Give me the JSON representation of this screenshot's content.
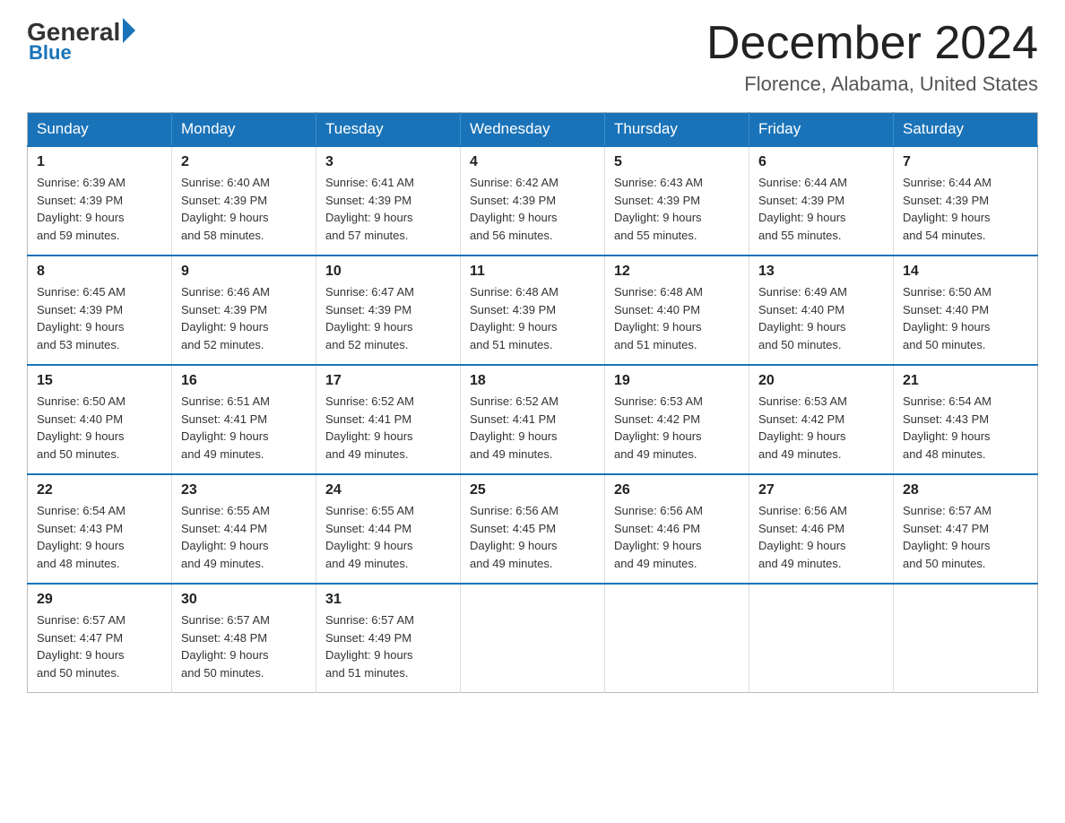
{
  "logo": {
    "general": "General",
    "blue": "Blue"
  },
  "header": {
    "month": "December 2024",
    "location": "Florence, Alabama, United States"
  },
  "weekdays": [
    "Sunday",
    "Monday",
    "Tuesday",
    "Wednesday",
    "Thursday",
    "Friday",
    "Saturday"
  ],
  "weeks": [
    [
      {
        "day": "1",
        "sunrise": "6:39 AM",
        "sunset": "4:39 PM",
        "daylight": "9 hours and 59 minutes."
      },
      {
        "day": "2",
        "sunrise": "6:40 AM",
        "sunset": "4:39 PM",
        "daylight": "9 hours and 58 minutes."
      },
      {
        "day": "3",
        "sunrise": "6:41 AM",
        "sunset": "4:39 PM",
        "daylight": "9 hours and 57 minutes."
      },
      {
        "day": "4",
        "sunrise": "6:42 AM",
        "sunset": "4:39 PM",
        "daylight": "9 hours and 56 minutes."
      },
      {
        "day": "5",
        "sunrise": "6:43 AM",
        "sunset": "4:39 PM",
        "daylight": "9 hours and 55 minutes."
      },
      {
        "day": "6",
        "sunrise": "6:44 AM",
        "sunset": "4:39 PM",
        "daylight": "9 hours and 55 minutes."
      },
      {
        "day": "7",
        "sunrise": "6:44 AM",
        "sunset": "4:39 PM",
        "daylight": "9 hours and 54 minutes."
      }
    ],
    [
      {
        "day": "8",
        "sunrise": "6:45 AM",
        "sunset": "4:39 PM",
        "daylight": "9 hours and 53 minutes."
      },
      {
        "day": "9",
        "sunrise": "6:46 AM",
        "sunset": "4:39 PM",
        "daylight": "9 hours and 52 minutes."
      },
      {
        "day": "10",
        "sunrise": "6:47 AM",
        "sunset": "4:39 PM",
        "daylight": "9 hours and 52 minutes."
      },
      {
        "day": "11",
        "sunrise": "6:48 AM",
        "sunset": "4:39 PM",
        "daylight": "9 hours and 51 minutes."
      },
      {
        "day": "12",
        "sunrise": "6:48 AM",
        "sunset": "4:40 PM",
        "daylight": "9 hours and 51 minutes."
      },
      {
        "day": "13",
        "sunrise": "6:49 AM",
        "sunset": "4:40 PM",
        "daylight": "9 hours and 50 minutes."
      },
      {
        "day": "14",
        "sunrise": "6:50 AM",
        "sunset": "4:40 PM",
        "daylight": "9 hours and 50 minutes."
      }
    ],
    [
      {
        "day": "15",
        "sunrise": "6:50 AM",
        "sunset": "4:40 PM",
        "daylight": "9 hours and 50 minutes."
      },
      {
        "day": "16",
        "sunrise": "6:51 AM",
        "sunset": "4:41 PM",
        "daylight": "9 hours and 49 minutes."
      },
      {
        "day": "17",
        "sunrise": "6:52 AM",
        "sunset": "4:41 PM",
        "daylight": "9 hours and 49 minutes."
      },
      {
        "day": "18",
        "sunrise": "6:52 AM",
        "sunset": "4:41 PM",
        "daylight": "9 hours and 49 minutes."
      },
      {
        "day": "19",
        "sunrise": "6:53 AM",
        "sunset": "4:42 PM",
        "daylight": "9 hours and 49 minutes."
      },
      {
        "day": "20",
        "sunrise": "6:53 AM",
        "sunset": "4:42 PM",
        "daylight": "9 hours and 49 minutes."
      },
      {
        "day": "21",
        "sunrise": "6:54 AM",
        "sunset": "4:43 PM",
        "daylight": "9 hours and 48 minutes."
      }
    ],
    [
      {
        "day": "22",
        "sunrise": "6:54 AM",
        "sunset": "4:43 PM",
        "daylight": "9 hours and 48 minutes."
      },
      {
        "day": "23",
        "sunrise": "6:55 AM",
        "sunset": "4:44 PM",
        "daylight": "9 hours and 49 minutes."
      },
      {
        "day": "24",
        "sunrise": "6:55 AM",
        "sunset": "4:44 PM",
        "daylight": "9 hours and 49 minutes."
      },
      {
        "day": "25",
        "sunrise": "6:56 AM",
        "sunset": "4:45 PM",
        "daylight": "9 hours and 49 minutes."
      },
      {
        "day": "26",
        "sunrise": "6:56 AM",
        "sunset": "4:46 PM",
        "daylight": "9 hours and 49 minutes."
      },
      {
        "day": "27",
        "sunrise": "6:56 AM",
        "sunset": "4:46 PM",
        "daylight": "9 hours and 49 minutes."
      },
      {
        "day": "28",
        "sunrise": "6:57 AM",
        "sunset": "4:47 PM",
        "daylight": "9 hours and 50 minutes."
      }
    ],
    [
      {
        "day": "29",
        "sunrise": "6:57 AM",
        "sunset": "4:47 PM",
        "daylight": "9 hours and 50 minutes."
      },
      {
        "day": "30",
        "sunrise": "6:57 AM",
        "sunset": "4:48 PM",
        "daylight": "9 hours and 50 minutes."
      },
      {
        "day": "31",
        "sunrise": "6:57 AM",
        "sunset": "4:49 PM",
        "daylight": "9 hours and 51 minutes."
      },
      null,
      null,
      null,
      null
    ]
  ],
  "labels": {
    "sunrise": "Sunrise:",
    "sunset": "Sunset:",
    "daylight": "Daylight:"
  }
}
